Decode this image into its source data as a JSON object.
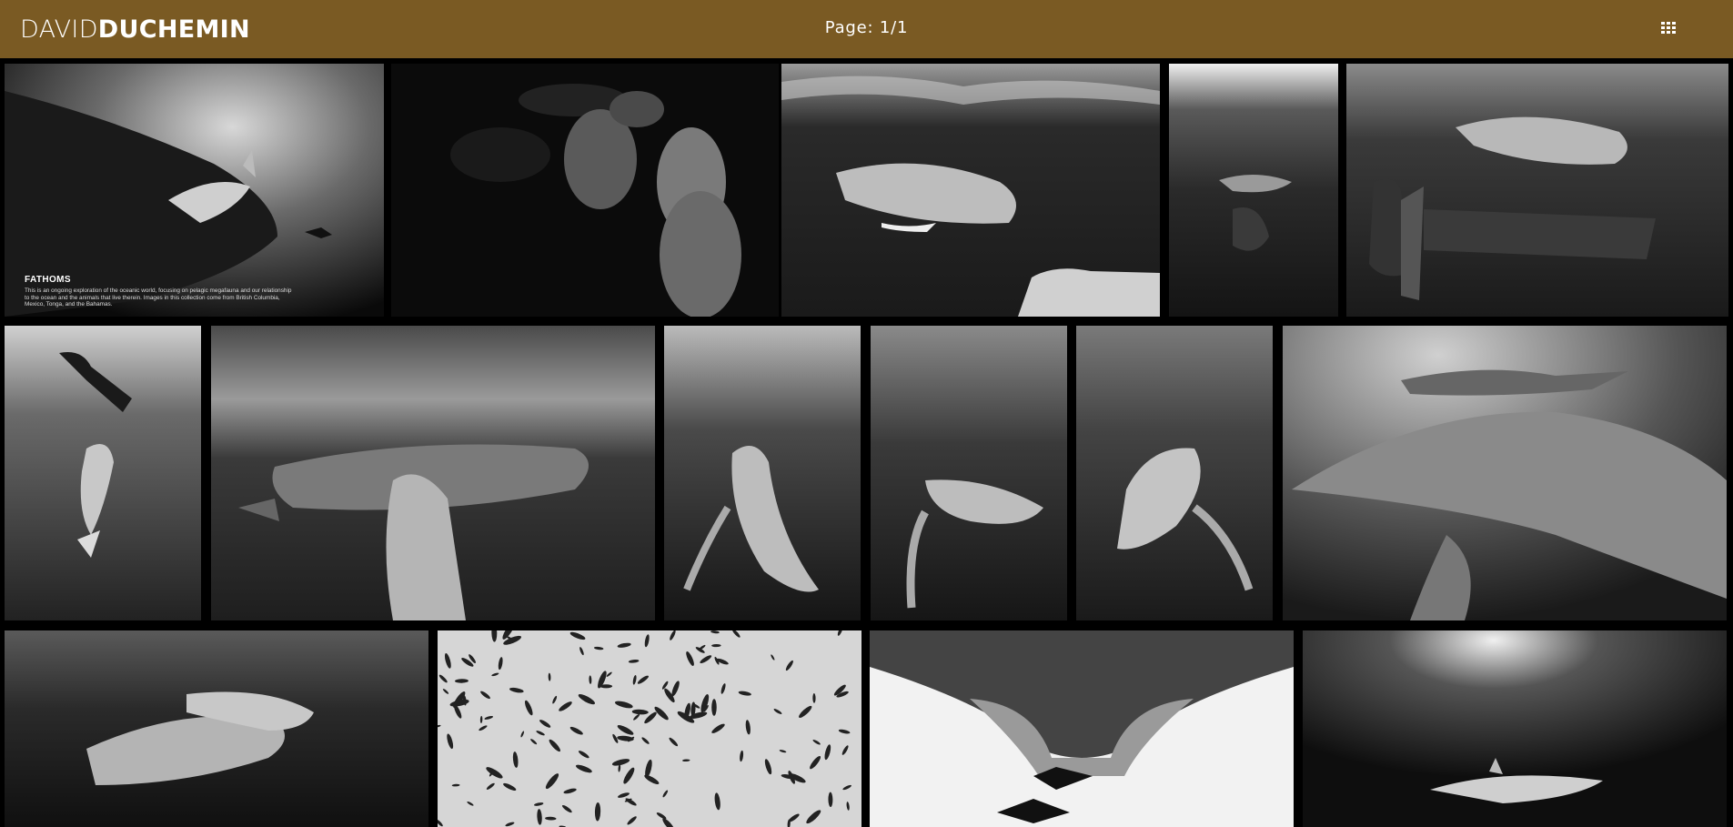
{
  "header": {
    "logo_light": "DAVID",
    "logo_bold": "DUCHEMIN",
    "page_label": "Page: 1/1",
    "background": "#7a5a23",
    "menu_icon": "grid-icon"
  },
  "gallery": {
    "featured": {
      "title": "FATHOMS",
      "description": "This is an ongoing exploration of the oceanic world, focusing on pelagic megafauna and our relationship to the ocean and the animals that live therein. Images in this collection come from British Columbia, Mexico, Tonga, and the Bahamas."
    },
    "photos": [
      "photo-shark-silhouette",
      "photo-sea-lions",
      "photo-whale-hand",
      "photo-whale-calf-surface",
      "photo-diver-whale",
      "photo-freediver-whale",
      "photo-humpback-pectoral",
      "photo-whale-vertical",
      "photo-calf-ascending",
      "photo-calf-belly",
      "photo-manta-remora",
      "photo-shark-pair",
      "photo-fish-school",
      "photo-manta-underside",
      "photo-shark-sunrays"
    ]
  }
}
